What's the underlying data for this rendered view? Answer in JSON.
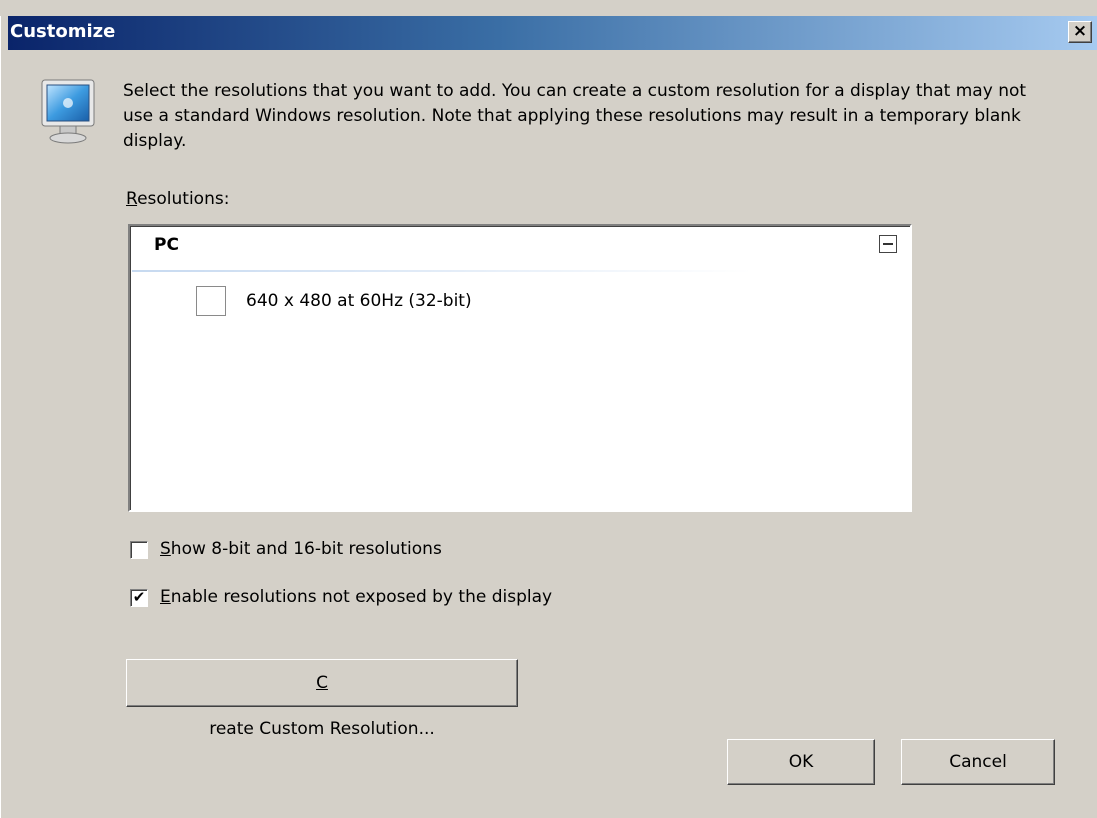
{
  "window": {
    "title": "Customize",
    "close_glyph": "×"
  },
  "icon": {
    "name": "monitor-icon"
  },
  "description": "Select the resolutions that you want to add. You can create a custom resolution for a display that may not use a standard Windows resolution. Note that applying these resolutions may result in a temporary blank display.",
  "resolutions_label": {
    "accel": "R",
    "rest": "esolutions:"
  },
  "list": {
    "group": "PC",
    "items": [
      {
        "label": "640 x 480 at 60Hz (32-bit)",
        "checked": false
      }
    ]
  },
  "options": [
    {
      "accel": "S",
      "rest": "how 8-bit and 16-bit resolutions",
      "checked": false
    },
    {
      "accel": "E",
      "rest": "nable resolutions not exposed by the display",
      "checked": true
    }
  ],
  "buttons": {
    "create": {
      "accel": "C",
      "rest": "reate Custom Resolution..."
    },
    "ok": "OK",
    "cancel": "Cancel"
  }
}
